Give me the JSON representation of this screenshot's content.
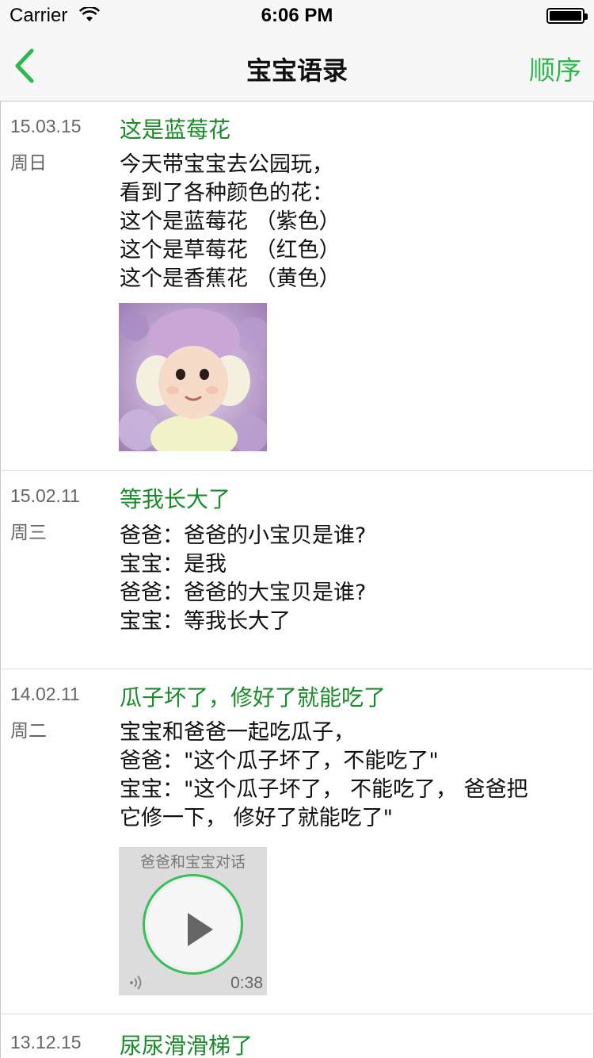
{
  "status_bar": {
    "carrier": "Carrier",
    "time": "6:06 PM"
  },
  "nav": {
    "title": "宝宝语录",
    "sort_label": "顺序",
    "accent_color": "#2db84d"
  },
  "entries": [
    {
      "date": "15.03.15",
      "weekday": "周日",
      "title": "这是蓝莓花",
      "body": "今天带宝宝去公园玩，\n看到了各种颜色的花：\n这个是蓝莓花 （紫色）\n这个是草莓花 （红色）\n这个是香蕉花 （黄色）",
      "attachment": "photo"
    },
    {
      "date": "15.02.11",
      "weekday": "周三",
      "title": "等我长大了",
      "body": "爸爸：爸爸的小宝贝是谁?\n宝宝：是我\n爸爸：爸爸的大宝贝是谁?\n宝宝：等我长大了"
    },
    {
      "date": "14.02.11",
      "weekday": "周二",
      "title": "瓜子坏了，修好了就能吃了",
      "body": "宝宝和爸爸一起吃瓜子，\n爸爸：\"这个瓜子坏了，不能吃了\"\n宝宝：\"这个瓜子坏了， 不能吃了， 爸爸把\n它修一下， 修好了就能吃了\"",
      "audio": {
        "title": "爸爸和宝宝对话",
        "duration": "0:38"
      }
    },
    {
      "date": "13.12.15",
      "weekday": "",
      "title": "尿尿滑滑梯了",
      "body": ""
    }
  ]
}
